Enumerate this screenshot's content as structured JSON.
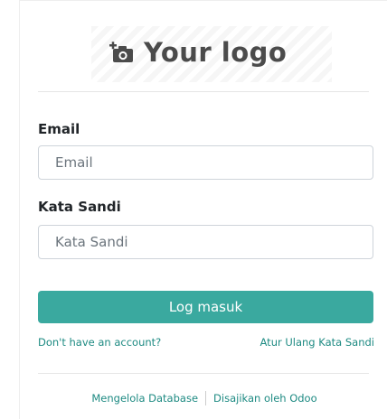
{
  "logo": {
    "text": "Your logo",
    "icon": "add-photo-icon"
  },
  "form": {
    "email_label": "Email",
    "email_placeholder": "Email",
    "email_value": "",
    "password_label": "Kata Sandi",
    "password_placeholder": "Kata Sandi",
    "password_value": "",
    "login_button": "Log masuk"
  },
  "links": {
    "signup": "Don't have an account?",
    "reset": "Atur Ulang Kata Sandi"
  },
  "footer": {
    "manage_db": "Mengelola Database",
    "powered_by": "Disajikan oleh Odoo"
  },
  "colors": {
    "primary": "#3aa99f",
    "link": "#1d8a82"
  }
}
